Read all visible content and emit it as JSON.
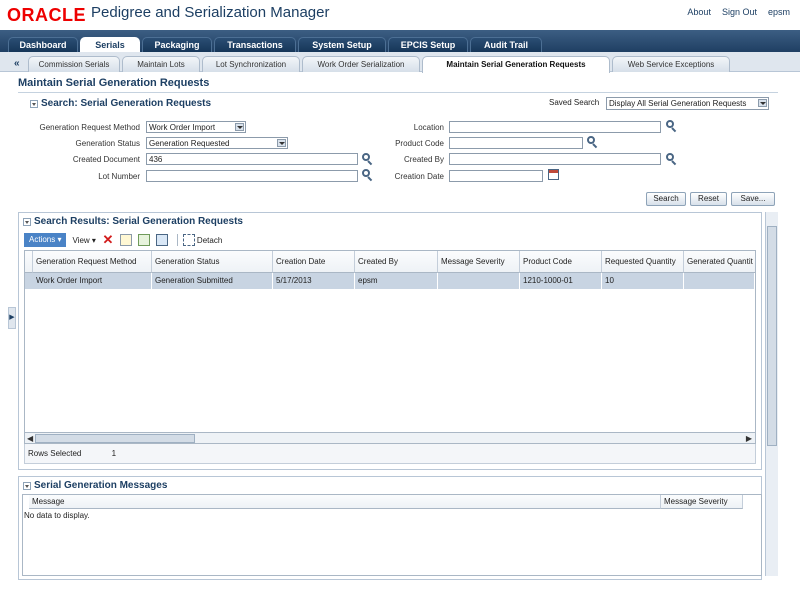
{
  "header": {
    "brand": "ORACLE",
    "title": "Pedigree and Serialization Manager",
    "links": [
      "About",
      "Sign Out",
      "epsm"
    ]
  },
  "main_tabs": [
    "Dashboard",
    "Serials",
    "Packaging",
    "Transactions",
    "System Setup",
    "EPCIS Setup",
    "Audit Trail"
  ],
  "main_tabs_active": "Serials",
  "sub_tabs": [
    "Commission Serials",
    "Maintain Lots",
    "Lot Synchronization",
    "Work Order Serialization",
    "Maintain Serial Generation Requests",
    "Web Service Exceptions"
  ],
  "sub_tabs_active": "Maintain Serial Generation Requests",
  "page": {
    "title": "Maintain Serial Generation Requests"
  },
  "search": {
    "title": "Search: Serial Generation Requests",
    "saved_search_label": "Saved Search",
    "saved_search_value": "Display All Serial Generation Requests",
    "fields": {
      "generation_request_method": {
        "label": "Generation Request Method",
        "value": "Work Order Import"
      },
      "generation_status": {
        "label": "Generation Status",
        "value": "Generation Requested"
      },
      "created_document": {
        "label": "Created Document",
        "value": "436"
      },
      "lot_number": {
        "label": "Lot Number",
        "value": ""
      },
      "location": {
        "label": "Location",
        "value": ""
      },
      "product_code": {
        "label": "Product Code",
        "value": ""
      },
      "created_by": {
        "label": "Created By",
        "value": ""
      },
      "creation_date": {
        "label": "Creation Date",
        "value": ""
      }
    },
    "buttons": {
      "search": "Search",
      "reset": "Reset",
      "save": "Save..."
    }
  },
  "results": {
    "title": "Search Results: Serial Generation Requests",
    "toolbar": {
      "actions": "Actions ▾",
      "view": "View ▾",
      "detach": "Detach"
    },
    "columns": [
      "Generation Request Method",
      "Generation Status",
      "Creation Date",
      "Created By",
      "Message Severity",
      "Product Code",
      "Requested Quantity",
      "Generated Quantit"
    ],
    "rows": [
      [
        "Work Order Import",
        "Generation Submitted",
        "5/17/2013",
        "epsm",
        "",
        "1210-1000-01",
        "10",
        ""
      ]
    ],
    "rows_selected_label": "Rows Selected",
    "rows_selected_value": "1"
  },
  "messages": {
    "title": "Serial Generation Messages",
    "columns": [
      "Message",
      "Message Severity"
    ],
    "empty_text": "No data to display."
  },
  "colors": {
    "header_blue": "#1d3f63",
    "oracle_red": "#e00000",
    "selected_row": "#c8d4e2",
    "actions_blue": "#4a83c6"
  }
}
